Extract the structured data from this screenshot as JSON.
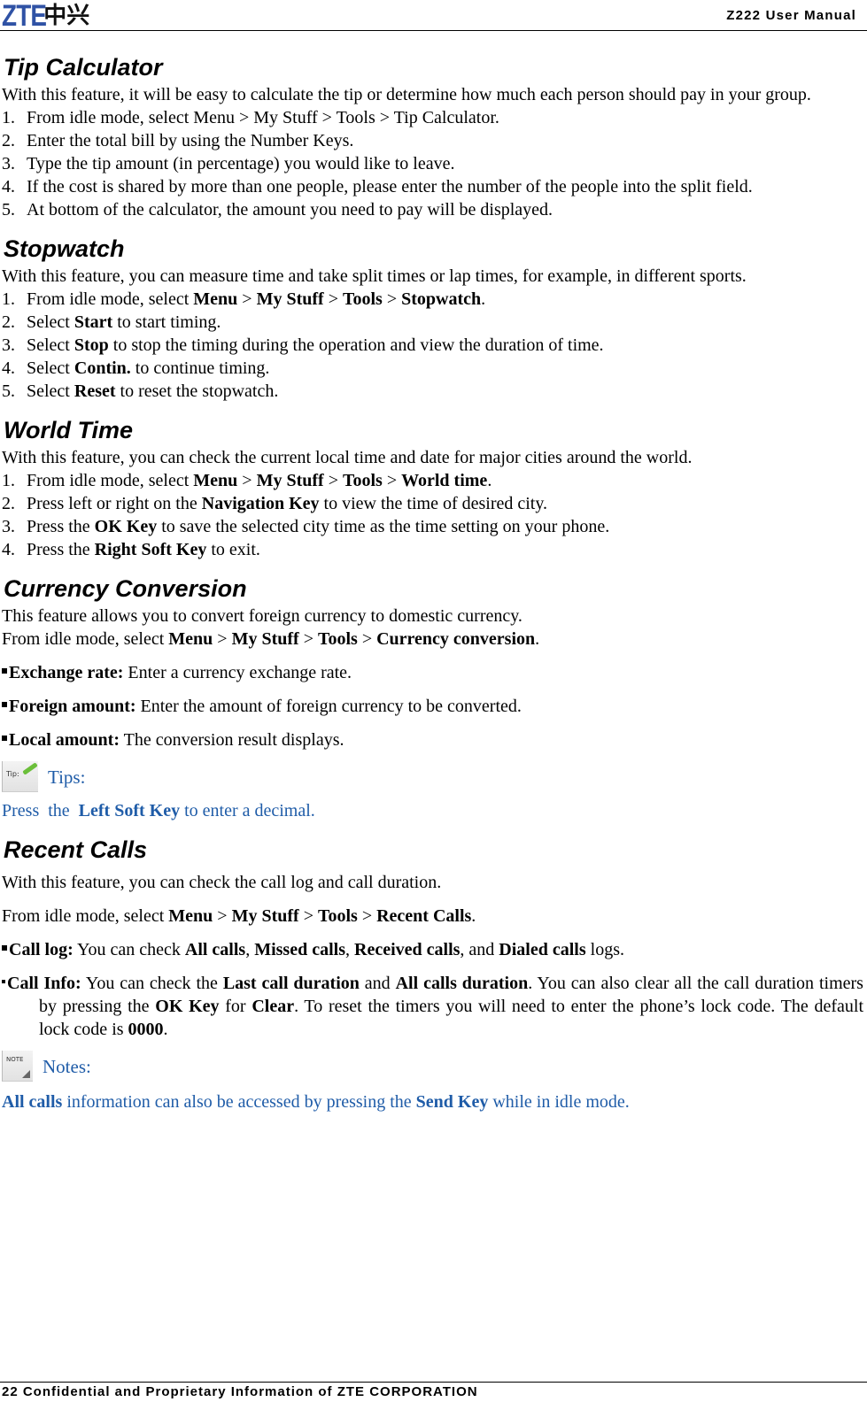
{
  "header": {
    "logo_latin": "ZTE",
    "logo_cn": "中兴",
    "manual_title": "Z222 User Manual"
  },
  "footer": {
    "text": "22 Confidential and Proprietary Information of ZTE CORPORATION"
  },
  "colors": {
    "note_text": "#1f5ca8",
    "logo_blue": "#2f52a5"
  },
  "tip_calculator": {
    "title": "Tip Calculator",
    "intro": "With this feature, it will be easy to calculate the tip or determine how much each person should pay in your group.",
    "steps": [
      {
        "num": "1.",
        "text": "From idle mode, select Menu > My Stuff > Tools > Tip Calculator."
      },
      {
        "num": "2.",
        "text": "Enter the total bill by using the Number Keys."
      },
      {
        "num": "3.",
        "text": "Type the tip amount (in percentage) you would like to leave."
      },
      {
        "num": "4.",
        "text": "If the cost is shared by more than one people, please enter the number of the people into the split field."
      },
      {
        "num": "5.",
        "text": "At bottom of the calculator, the amount you need to pay will be displayed."
      }
    ]
  },
  "stopwatch": {
    "title": "Stopwatch",
    "intro": "With this feature, you can measure time and take split times or lap times, for example, in different sports.",
    "steps": [
      {
        "num": "1.",
        "pre": "From idle mode, select ",
        "b1": "Menu",
        "s1": " > ",
        "b2": "My Stuff",
        "s2": " > ",
        "b3": "Tools",
        "s3": " > ",
        "b4": "Stopwatch",
        "post": "."
      },
      {
        "num": "2.",
        "pre": "Select ",
        "bold": "Start",
        "post": " to start timing."
      },
      {
        "num": "3.",
        "pre": "Select ",
        "bold": "Stop",
        "post": " to stop the timing during the operation and view the duration of time."
      },
      {
        "num": "4.",
        "pre": "Select ",
        "bold": "Contin.",
        "post": " to continue timing."
      },
      {
        "num": "5.",
        "pre": "Select ",
        "bold": "Reset",
        "post": " to reset the stopwatch."
      }
    ]
  },
  "world_time": {
    "title": "World Time",
    "intro": "With this feature, you can check the current local time and date for major cities around the world.",
    "steps": [
      {
        "num": "1.",
        "pre": "From idle mode, select ",
        "b1": "Menu",
        "s1": " > ",
        "b2": "My Stuff",
        "s2": " > ",
        "b3": "Tools",
        "s3": " > ",
        "b4": "World time",
        "post": "."
      },
      {
        "num": "2.",
        "pre": "Press left or right on the ",
        "bold": "Navigation Key",
        "post": " to view the time of desired city."
      },
      {
        "num": "3.",
        "pre": "Press the ",
        "bold": "OK Key",
        "post": " to save the selected city time as the time setting on your phone."
      },
      {
        "num": "4.",
        "pre": "Press the ",
        "bold": "Right Soft Key",
        "post": " to exit."
      }
    ]
  },
  "currency_conversion": {
    "title": "Currency Conversion",
    "intro": "This feature allows you to convert foreign currency to domestic currency.",
    "path": {
      "pre": "From idle mode, select ",
      "b1": "Menu",
      "s1": " > ",
      "b2": "My Stuff",
      "s2": " > ",
      "b3": "Tools",
      "s3": " > ",
      "b4": "Currency conversion",
      "post": "."
    },
    "bullets": [
      {
        "label": "Exchange rate:",
        "text": " Enter a currency exchange rate."
      },
      {
        "label": "Foreign amount:",
        "text": " Enter the amount of foreign currency to be converted."
      },
      {
        "label": "Local amount:",
        "text": " The conversion result displays."
      }
    ],
    "tip": {
      "icon_text": "Tip:",
      "label": "Tips:",
      "pre": "Press  the  ",
      "bold": "Left Soft Key",
      "post": " to enter a decimal."
    }
  },
  "recent_calls": {
    "title": "Recent Calls",
    "intro": "With this feature, you can check the call log and call duration.",
    "path": {
      "pre": "From idle mode, select ",
      "b1": "Menu",
      "s1": " > ",
      "b2": "My Stuff",
      "s2": " > ",
      "b3": "Tools",
      "s3": " > ",
      "b4": "Recent Calls",
      "post": "."
    },
    "call_log": {
      "label": "Call log:",
      "t1": " You can check ",
      "b1": "All calls",
      "t2": ", ",
      "b2": "Missed calls",
      "t3": ", ",
      "b3": "Received calls",
      "t4": ", and ",
      "b4": "Dialed calls",
      "t5": " logs."
    },
    "call_info": {
      "label": "Call Info:",
      "t1": " You can check the ",
      "b1": "Last call duration",
      "t2": " and ",
      "b2": "All calls duration",
      "t3": ". You can also clear all the call duration timers by pressing the ",
      "b3": "OK Key",
      "t4": " for ",
      "b4": "Clear",
      "t5": ". To reset the timers you will need to enter the phone’s lock code. The default lock code is ",
      "b5": "0000",
      "t6": "."
    },
    "note": {
      "icon_text": "NOTE",
      "label": "Notes:",
      "bold1": "All calls",
      "mid": " information can also be accessed by pressing the ",
      "bold2": "Send Key",
      "post": " while in idle mode."
    }
  }
}
